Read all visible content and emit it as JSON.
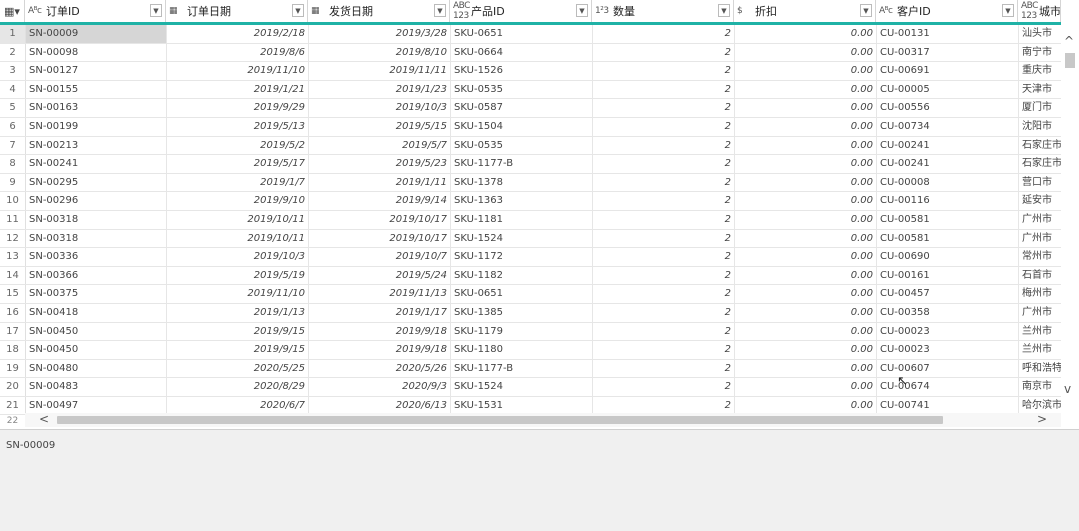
{
  "columns": [
    {
      "icon": "Aᴮᴄ",
      "label": "订单ID"
    },
    {
      "icon": "▦",
      "label": "订单日期"
    },
    {
      "icon": "▦",
      "label": "发货日期"
    },
    {
      "icon": "ABC 123",
      "label": "产品ID"
    },
    {
      "icon": "1²3",
      "label": "数量"
    },
    {
      "icon": "$",
      "label": "折扣"
    },
    {
      "icon": "Aᴮᴄ",
      "label": "客户ID"
    },
    {
      "icon": "ABC 123",
      "label": "城市"
    }
  ],
  "corner_icon": "▦▾",
  "rows": [
    {
      "n": "1",
      "c": [
        "SN-00009",
        "2019/2/18",
        "2019/3/28",
        "SKU-0651",
        "2",
        "0.00",
        "CU-00131",
        "汕头市"
      ]
    },
    {
      "n": "2",
      "c": [
        "SN-00098",
        "2019/8/6",
        "2019/8/10",
        "SKU-0664",
        "2",
        "0.00",
        "CU-00317",
        "南宁市"
      ]
    },
    {
      "n": "3",
      "c": [
        "SN-00127",
        "2019/11/10",
        "2019/11/11",
        "SKU-1526",
        "2",
        "0.00",
        "CU-00691",
        "重庆市"
      ]
    },
    {
      "n": "4",
      "c": [
        "SN-00155",
        "2019/1/21",
        "2019/1/23",
        "SKU-0535",
        "2",
        "0.00",
        "CU-00005",
        "天津市"
      ]
    },
    {
      "n": "5",
      "c": [
        "SN-00163",
        "2019/9/29",
        "2019/10/3",
        "SKU-0587",
        "2",
        "0.00",
        "CU-00556",
        "厦门市"
      ]
    },
    {
      "n": "6",
      "c": [
        "SN-00199",
        "2019/5/13",
        "2019/5/15",
        "SKU-1504",
        "2",
        "0.00",
        "CU-00734",
        "沈阳市"
      ]
    },
    {
      "n": "7",
      "c": [
        "SN-00213",
        "2019/5/2",
        "2019/5/7",
        "SKU-0535",
        "2",
        "0.00",
        "CU-00241",
        "石家庄市"
      ]
    },
    {
      "n": "8",
      "c": [
        "SN-00241",
        "2019/5/17",
        "2019/5/23",
        "SKU-1177-B",
        "2",
        "0.00",
        "CU-00241",
        "石家庄市"
      ]
    },
    {
      "n": "9",
      "c": [
        "SN-00295",
        "2019/1/7",
        "2019/1/11",
        "SKU-1378",
        "2",
        "0.00",
        "CU-00008",
        "营口市"
      ]
    },
    {
      "n": "10",
      "c": [
        "SN-00296",
        "2019/9/10",
        "2019/9/14",
        "SKU-1363",
        "2",
        "0.00",
        "CU-00116",
        "延安市"
      ]
    },
    {
      "n": "11",
      "c": [
        "SN-00318",
        "2019/10/11",
        "2019/10/17",
        "SKU-1181",
        "2",
        "0.00",
        "CU-00581",
        "广州市"
      ]
    },
    {
      "n": "12",
      "c": [
        "SN-00318",
        "2019/10/11",
        "2019/10/17",
        "SKU-1524",
        "2",
        "0.00",
        "CU-00581",
        "广州市"
      ]
    },
    {
      "n": "13",
      "c": [
        "SN-00336",
        "2019/10/3",
        "2019/10/7",
        "SKU-1172",
        "2",
        "0.00",
        "CU-00690",
        "常州市"
      ]
    },
    {
      "n": "14",
      "c": [
        "SN-00366",
        "2019/5/19",
        "2019/5/24",
        "SKU-1182",
        "2",
        "0.00",
        "CU-00161",
        "石首市"
      ]
    },
    {
      "n": "15",
      "c": [
        "SN-00375",
        "2019/11/10",
        "2019/11/13",
        "SKU-0651",
        "2",
        "0.00",
        "CU-00457",
        "梅州市"
      ]
    },
    {
      "n": "16",
      "c": [
        "SN-00418",
        "2019/1/13",
        "2019/1/17",
        "SKU-1385",
        "2",
        "0.00",
        "CU-00358",
        "广州市"
      ]
    },
    {
      "n": "17",
      "c": [
        "SN-00450",
        "2019/9/15",
        "2019/9/18",
        "SKU-1179",
        "2",
        "0.00",
        "CU-00023",
        "兰州市"
      ]
    },
    {
      "n": "18",
      "c": [
        "SN-00450",
        "2019/9/15",
        "2019/9/18",
        "SKU-1180",
        "2",
        "0.00",
        "CU-00023",
        "兰州市"
      ]
    },
    {
      "n": "19",
      "c": [
        "SN-00480",
        "2020/5/25",
        "2020/5/26",
        "SKU-1177-B",
        "2",
        "0.00",
        "CU-00607",
        "呼和浩特"
      ]
    },
    {
      "n": "20",
      "c": [
        "SN-00483",
        "2020/8/29",
        "2020/9/3",
        "SKU-1524",
        "2",
        "0.00",
        "CU-00674",
        "南京市"
      ]
    },
    {
      "n": "21",
      "c": [
        "SN-00497",
        "2020/6/7",
        "2020/6/13",
        "SKU-1531",
        "2",
        "0.00",
        "CU-00741",
        "哈尔滨市"
      ]
    }
  ],
  "partial_row_number": "22",
  "status_value": "SN-00009",
  "accent_color": "#1fb2a6"
}
